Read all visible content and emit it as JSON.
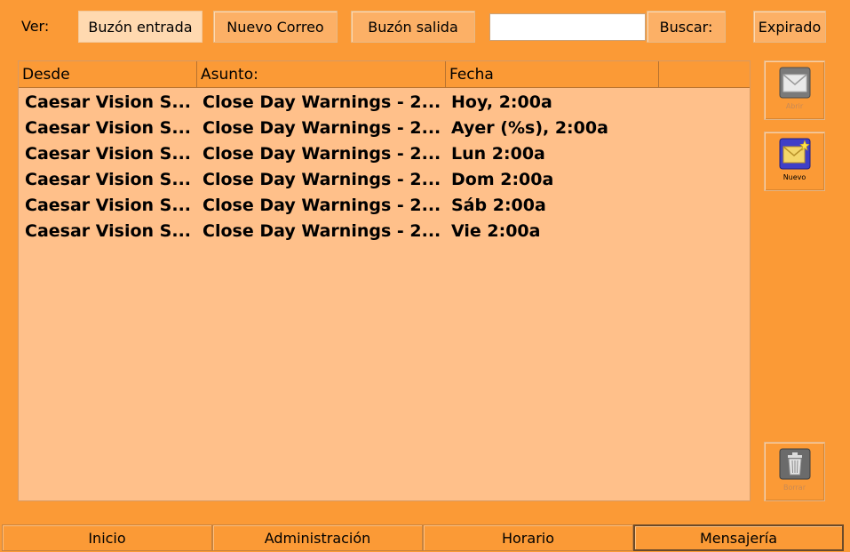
{
  "toolbar": {
    "ver_label": "Ver:",
    "inbox_label": "Buzón entrada",
    "new_mail_label": "Nuevo Correo",
    "outbox_label": "Buzón salida",
    "search_value": "",
    "search_button_label": "Buscar:",
    "expired_label": "Expirado"
  },
  "list": {
    "headers": [
      "Desde",
      "Asunto:",
      "Fecha"
    ],
    "rows": [
      {
        "from": "Caesar Vision S...",
        "subject": "Close Day Warnings - 2...",
        "date": "Hoy, 2:00a"
      },
      {
        "from": "Caesar Vision S...",
        "subject": "Close Day Warnings - 2...",
        "date": "Ayer (%s), 2:00a"
      },
      {
        "from": "Caesar Vision S...",
        "subject": "Close Day Warnings - 2...",
        "date": "Lun 2:00a"
      },
      {
        "from": "Caesar Vision S...",
        "subject": "Close Day Warnings - 2...",
        "date": "Dom 2:00a"
      },
      {
        "from": "Caesar Vision S...",
        "subject": "Close Day Warnings - 2...",
        "date": "Sáb 2:00a"
      },
      {
        "from": "Caesar Vision S...",
        "subject": "Close Day Warnings - 2...",
        "date": "Vie 2:00a"
      }
    ]
  },
  "side": {
    "open_label": "Abrir",
    "new_label": "Nuevo",
    "delete_label": "Borrar"
  },
  "tabs": [
    "Inicio",
    "Administración",
    "Horario",
    "Mensajería"
  ],
  "colors": {
    "background": "#fb9a36",
    "list_background": "#ffc08a",
    "active_button": "#ffd9b0"
  }
}
